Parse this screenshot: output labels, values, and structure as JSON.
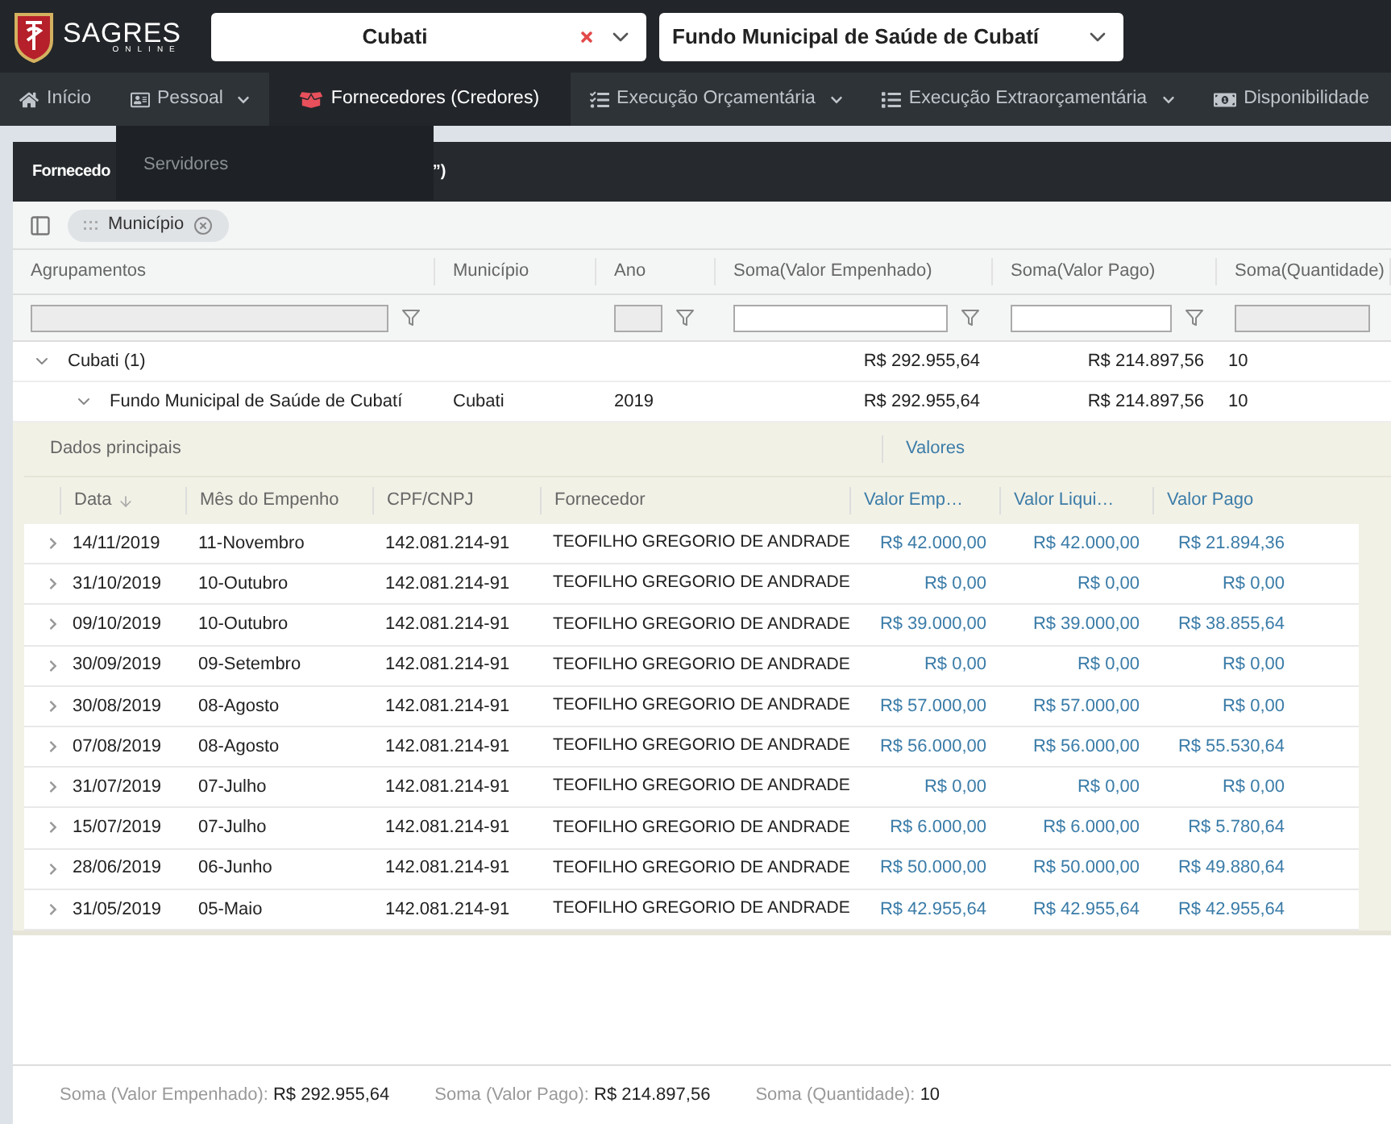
{
  "brand": {
    "name": "SAGRES",
    "tagline": "ONLINE"
  },
  "selectors": [
    {
      "value": "Cubati",
      "clearable": true
    },
    {
      "value": "Fundo Municipal de Saúde de Cubatí",
      "clearable": false
    }
  ],
  "nav": [
    {
      "label": "Início",
      "caret": false,
      "selected": false
    },
    {
      "label": "Pessoal",
      "caret": true,
      "selected": false
    },
    {
      "label": "Fornecedores (Credores)",
      "caret": false,
      "selected": true
    },
    {
      "label": "Execução Orçamentária",
      "caret": true,
      "selected": false
    },
    {
      "label": "Execução Extraorçamentária",
      "caret": true,
      "selected": false
    },
    {
      "label": "Disponibilidade",
      "caret": false,
      "selected": false
    }
  ],
  "dropdown": {
    "items": [
      "Servidores"
    ]
  },
  "panel": {
    "title_start": "Fornecedo",
    "title_end": "”)"
  },
  "group_chips": [
    "Município"
  ],
  "grid": {
    "columns": [
      {
        "label": "Agrupamentos",
        "filter": {
          "disabled": true
        }
      },
      {
        "label": "Município"
      },
      {
        "label": "Ano",
        "filter": {
          "disabled": true
        }
      },
      {
        "label": "Soma(Valor Empenhado)",
        "filter": {
          "disabled": false
        }
      },
      {
        "label": "Soma(Valor Pago)",
        "filter": {
          "disabled": false
        }
      },
      {
        "label": "Soma(Quantidade)",
        "filter": {
          "disabled": true
        }
      }
    ],
    "groups": [
      {
        "label": "Cubati (1)",
        "empenhado": "R$ 292.955,64",
        "pago": "R$ 214.897,56",
        "quantidade": "10",
        "expanded": true
      },
      {
        "label": "Fundo Municipal de Saúde de Cubatí",
        "municipio": "Cubati",
        "ano": "2019",
        "empenhado": "R$ 292.955,64",
        "pago": "R$ 214.897,56",
        "quantidade": "10",
        "expanded": true
      }
    ]
  },
  "detail": {
    "band_main": "Dados principais",
    "band_values": "Valores",
    "columns": [
      "Data",
      "Mês do Empenho",
      "CPF/CNPJ",
      "Fornecedor",
      "Valor Emp…",
      "Valor Liqui…",
      "Valor Pago"
    ],
    "rows": [
      {
        "data": "14/11/2019",
        "mes": "11-Novembro",
        "cpf": "142.081.214-91",
        "fornecedor": "TEOFILHO GREGORIO DE ANDRADE",
        "emp": "R$ 42.000,00",
        "liq": "R$ 42.000,00",
        "pago": "R$ 21.894,36"
      },
      {
        "data": "31/10/2019",
        "mes": "10-Outubro",
        "cpf": "142.081.214-91",
        "fornecedor": "TEOFILHO GREGORIO DE ANDRADE",
        "emp": "R$ 0,00",
        "liq": "R$ 0,00",
        "pago": "R$ 0,00"
      },
      {
        "data": "09/10/2019",
        "mes": "10-Outubro",
        "cpf": "142.081.214-91",
        "fornecedor": "TEOFILHO GREGORIO DE ANDRADE",
        "emp": "R$ 39.000,00",
        "liq": "R$ 39.000,00",
        "pago": "R$ 38.855,64"
      },
      {
        "data": "30/09/2019",
        "mes": "09-Setembro",
        "cpf": "142.081.214-91",
        "fornecedor": "TEOFILHO GREGORIO DE ANDRADE",
        "emp": "R$ 0,00",
        "liq": "R$ 0,00",
        "pago": "R$ 0,00"
      },
      {
        "data": "30/08/2019",
        "mes": "08-Agosto",
        "cpf": "142.081.214-91",
        "fornecedor": "TEOFILHO GREGORIO DE ANDRADE",
        "emp": "R$ 57.000,00",
        "liq": "R$ 57.000,00",
        "pago": "R$ 0,00"
      },
      {
        "data": "07/08/2019",
        "mes": "08-Agosto",
        "cpf": "142.081.214-91",
        "fornecedor": "TEOFILHO GREGORIO DE ANDRADE",
        "emp": "R$ 56.000,00",
        "liq": "R$ 56.000,00",
        "pago": "R$ 55.530,64"
      },
      {
        "data": "31/07/2019",
        "mes": "07-Julho",
        "cpf": "142.081.214-91",
        "fornecedor": "TEOFILHO GREGORIO DE ANDRADE",
        "emp": "R$ 0,00",
        "liq": "R$ 0,00",
        "pago": "R$ 0,00"
      },
      {
        "data": "15/07/2019",
        "mes": "07-Julho",
        "cpf": "142.081.214-91",
        "fornecedor": "TEOFILHO GREGORIO DE ANDRADE",
        "emp": "R$ 6.000,00",
        "liq": "R$ 6.000,00",
        "pago": "R$ 5.780,64"
      },
      {
        "data": "28/06/2019",
        "mes": "06-Junho",
        "cpf": "142.081.214-91",
        "fornecedor": "TEOFILHO GREGORIO DE ANDRADE",
        "emp": "R$ 50.000,00",
        "liq": "R$ 50.000,00",
        "pago": "R$ 49.880,64"
      },
      {
        "data": "31/05/2019",
        "mes": "05-Maio",
        "cpf": "142.081.214-91",
        "fornecedor": "TEOFILHO GREGORIO DE ANDRADE",
        "emp": "R$ 42.955,64",
        "liq": "R$ 42.955,64",
        "pago": "R$ 42.955,64"
      }
    ]
  },
  "footer": [
    {
      "label": "Soma (Valor Empenhado):",
      "value": "R$ 292.955,64"
    },
    {
      "label": "Soma (Valor Pago):",
      "value": "R$ 214.897,56"
    },
    {
      "label": "Soma (Quantidade):",
      "value": "10"
    }
  ]
}
